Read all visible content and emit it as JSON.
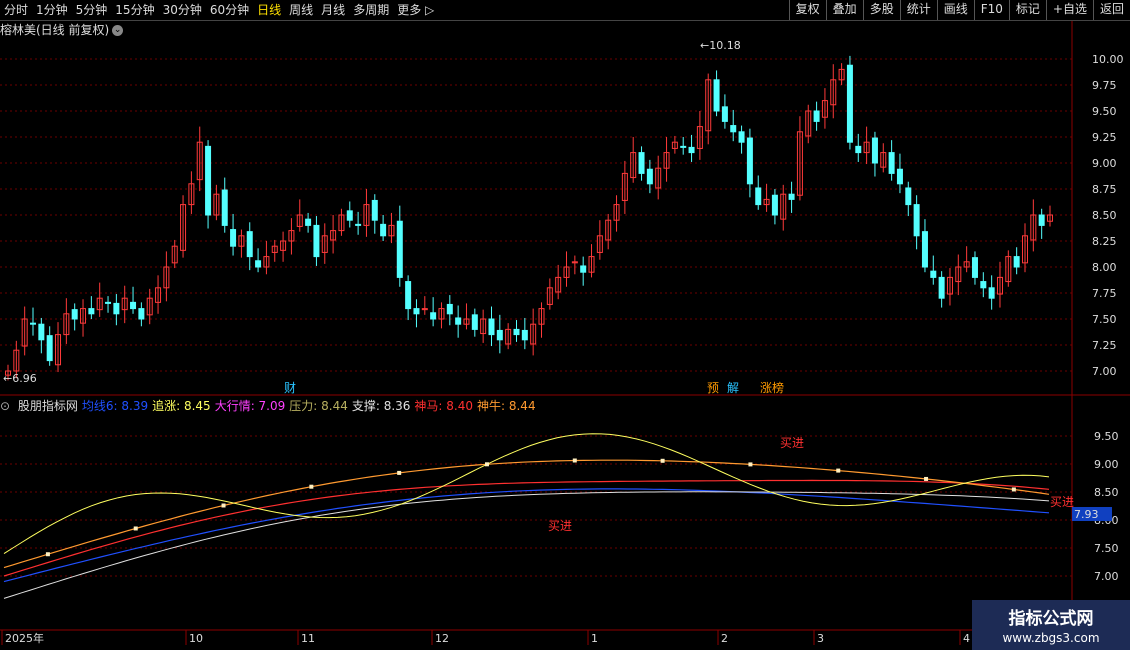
{
  "toolbar": {
    "periods": [
      "分时",
      "1分钟",
      "5分钟",
      "15分钟",
      "30分钟",
      "60分钟",
      "日线",
      "周线",
      "月线",
      "多周期",
      "更多 ▷"
    ],
    "active_period": "日线",
    "actions": [
      "复权",
      "叠加",
      "多股",
      "统计",
      "画线",
      "F10",
      "标记",
      "+自选",
      "返回"
    ]
  },
  "title": "榕林美(日线 前复权)",
  "price_labels": [
    "10.00",
    "9.75",
    "9.50",
    "9.25",
    "9.00",
    "8.75",
    "8.50",
    "8.25",
    "8.00",
    "7.75",
    "7.50",
    "7.25",
    "7.00"
  ],
  "hi_label": "10.18",
  "lo_label": "6.96",
  "events": [
    {
      "label": "财",
      "color": "#29c3ff"
    },
    {
      "label": "预",
      "color": "#ff9a00"
    },
    {
      "label": "解",
      "color": "#29c3ff"
    },
    {
      "label": "涨榜",
      "color": "#ff9a00"
    }
  ],
  "indicator": {
    "name": "股朋指标网",
    "items": [
      {
        "label": "均线6: 8.39",
        "color": "#2050ff"
      },
      {
        "label": "追涨: 8.45",
        "color": "#ffff60"
      },
      {
        "label": "大行情: 7.09",
        "color": "#ff40ff"
      },
      {
        "label": "压力: 8.44",
        "color": "#b8b060"
      },
      {
        "label": "支撑: 8.36",
        "color": "#e0e0e0"
      },
      {
        "label": "神马: 8.40",
        "color": "#ff3030"
      },
      {
        "label": "神牛: 8.44",
        "color": "#ff9a30"
      }
    ],
    "price_labels": [
      "9.50",
      "9.00",
      "8.50",
      "8.00",
      "7.50",
      "7.00"
    ],
    "current_value": "7.93",
    "signals": [
      "买进",
      "买进",
      "买进"
    ]
  },
  "dates": [
    "2025年",
    "10",
    "11",
    "12",
    "1",
    "2",
    "3",
    "4"
  ],
  "watermark": {
    "line1": "指标公式网",
    "line2": "www.zbgs3.com"
  },
  "colors": {
    "up": "#ff3a3a",
    "down": "#54ffff",
    "grid": "#6b0000"
  }
}
